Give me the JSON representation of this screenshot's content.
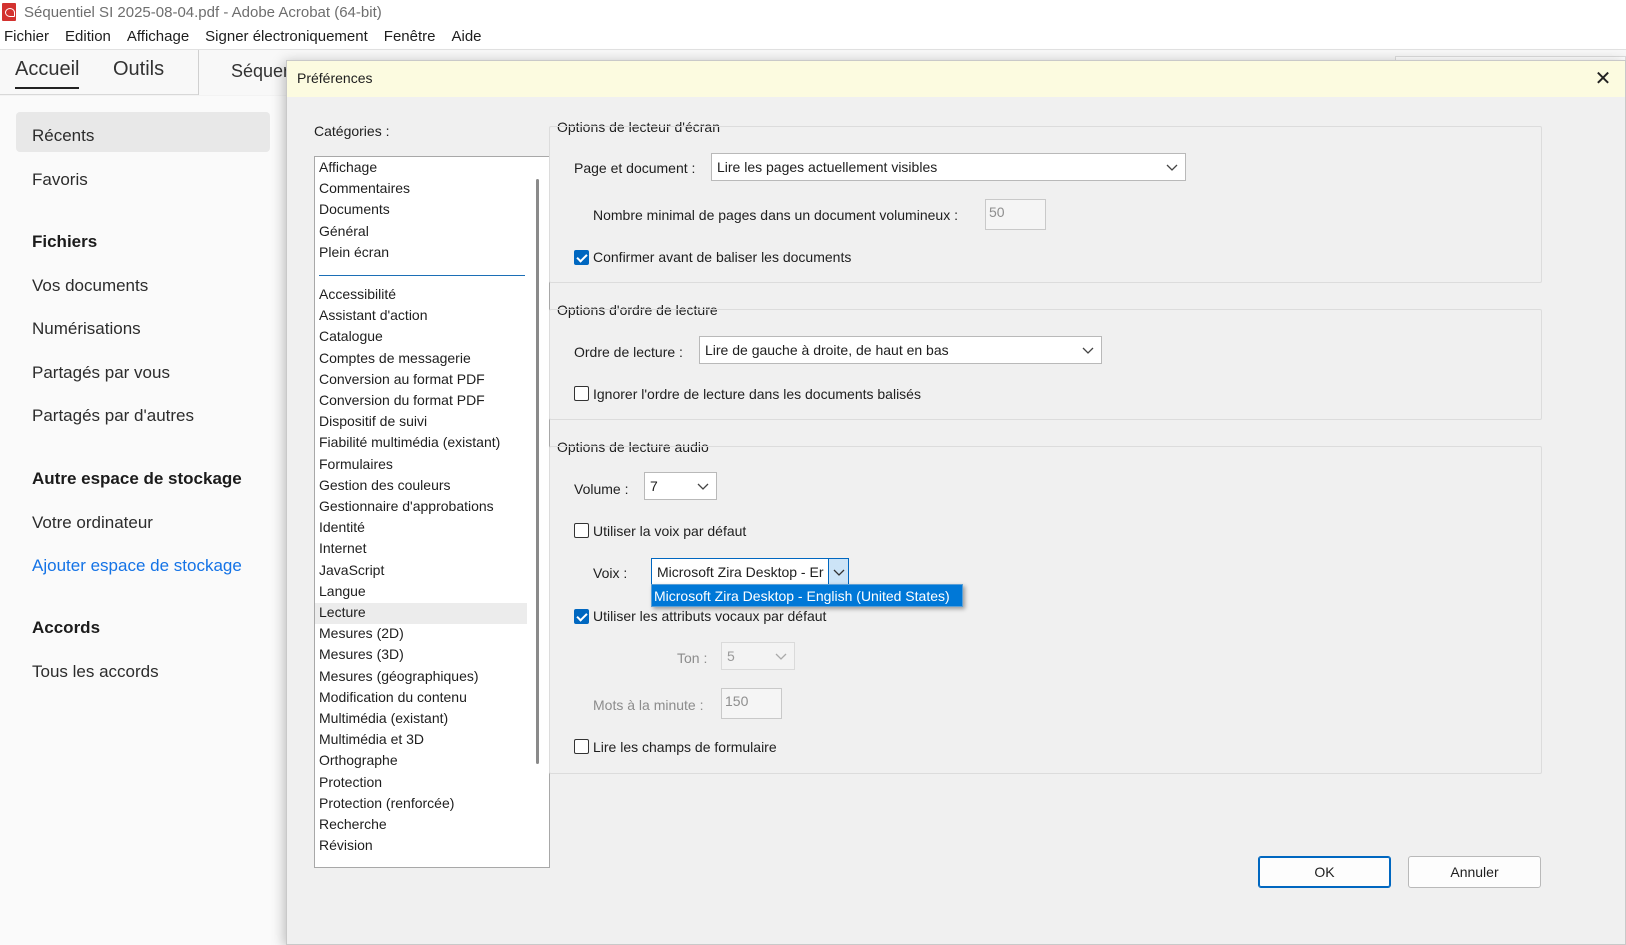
{
  "window": {
    "title": "Séquentiel SI 2025-08-04.pdf - Adobe Acrobat (64-bit)"
  },
  "menubar": [
    "Fichier",
    "Edition",
    "Affichage",
    "Signer électroniquement",
    "Fenêtre",
    "Aide"
  ],
  "tabs": {
    "home": "Accueil",
    "tools": "Outils",
    "document": "Séquen"
  },
  "sidebar": {
    "recents": "Récents",
    "favorites": "Favoris",
    "files_heading": "Fichiers",
    "your_documents": "Vos documents",
    "scans": "Numérisations",
    "shared_by_you": "Partagés par vous",
    "shared_by_others": "Partagés par d'autres",
    "other_storage_heading": "Autre espace de stockage",
    "your_computer": "Votre ordinateur",
    "add_storage": "Ajouter espace de stockage",
    "agreements_heading": "Accords",
    "all_agreements": "Tous les accords"
  },
  "dialog": {
    "title": "Préférences",
    "categories_label": "Catégories :",
    "categories_top": [
      "Affichage",
      "Commentaires",
      "Documents",
      "Général",
      "Plein écran"
    ],
    "categories": [
      "Accessibilité",
      "Assistant d'action",
      "Catalogue",
      "Comptes de messagerie",
      "Conversion au format PDF",
      "Conversion du format PDF",
      "Dispositif de suivi",
      "Fiabilité multimédia (existant)",
      "Formulaires",
      "Gestion des couleurs",
      "Gestionnaire d'approbations",
      "Identité",
      "Internet",
      "JavaScript",
      "Langue",
      "Lecture",
      "Mesures (2D)",
      "Mesures (3D)",
      "Mesures (géographiques)",
      "Modification du contenu",
      "Multimédia (existant)",
      "Multimédia et 3D",
      "Orthographe",
      "Protection",
      "Protection (renforcée)",
      "Recherche",
      "Révision"
    ],
    "selected_category": "Lecture",
    "screen_reader": {
      "title": "Options de lecteur d'écran",
      "page_doc_label": "Page et document :",
      "page_doc_value": "Lire les pages actuellement visibles",
      "min_pages_label": "Nombre minimal de pages dans un document volumineux :",
      "min_pages_value": "50",
      "confirm_tag_label": "Confirmer avant de baliser les documents",
      "confirm_tag_checked": true
    },
    "reading_order": {
      "title": "Options d'ordre de lecture",
      "order_label": "Ordre de lecture :",
      "order_value": "Lire de gauche à droite, de haut en bas",
      "ignore_label": "Ignorer l'ordre de lecture dans les documents balisés",
      "ignore_checked": false
    },
    "audio": {
      "title": "Options de lecture audio",
      "volume_label": "Volume :",
      "volume_value": "7",
      "default_voice_label": "Utiliser la voix par défaut",
      "default_voice_checked": false,
      "voice_label": "Voix :",
      "voice_value": "Microsoft Zira Desktop - Er",
      "voice_option": "Microsoft Zira Desktop - English (United States)",
      "default_attrs_label": "Utiliser les attributs vocaux par défaut",
      "default_attrs_checked": true,
      "pitch_label": "Ton :",
      "pitch_value": "5",
      "wpm_label": "Mots à la minute :",
      "wpm_value": "150",
      "read_fields_label": "Lire les champs de formulaire",
      "read_fields_checked": false
    },
    "ok_label": "OK",
    "cancel_label": "Annuler"
  },
  "colors": {
    "accent": "#0067c0",
    "dropdown_highlight": "#0078d7",
    "title_bar_dialog": "#fcfbe0",
    "link": "#1473e6"
  }
}
